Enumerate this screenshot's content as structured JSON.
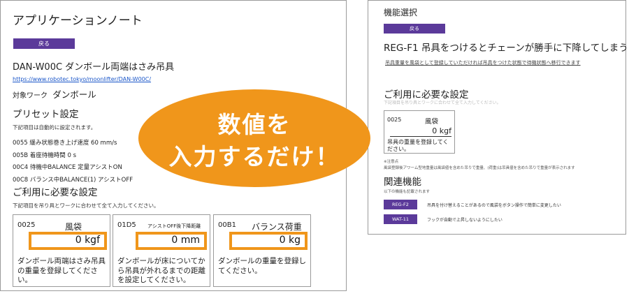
{
  "left": {
    "title": "アプリケーションノート",
    "back_label": "戻る",
    "heading": "DAN-W00C ダンボール両端はさみ吊具",
    "url": "https://www.robotec.tokyo/moonlifter/DAN-W00C/",
    "work_label": "対象ワーク",
    "work_value": "ダンボール",
    "preset_title": "プリセット設定",
    "preset_note": "下記項目は自動的に設定されます。",
    "preset_items": [
      "0055 緩み状態巻き上げ速度 60 mm/s",
      "005B 着座待機時間 0 s",
      "00C4 待機中BALANCE 定量アシストON",
      "00C8 バランス中BALANCE(1) アシストOFF"
    ],
    "required_title": "ご利用に必要な設定",
    "required_note": "下記項目を吊り具とワークに合わせて全て入力してください。",
    "cards": [
      {
        "code": "0025",
        "name": "風袋",
        "value": "0 kgf",
        "desc": "ダンボール両端はさみ吊具の重量を登録してください。"
      },
      {
        "code": "01D5",
        "name": "アシストOFF後下降距離",
        "value": "0 mm",
        "desc": "ダンボールが床についてから吊具が外れるまでの距離を設定してください。"
      },
      {
        "code": "00B1",
        "name": "バランス荷重",
        "value": "0 kg",
        "desc": "ダンボールの重量を登録してください。"
      }
    ]
  },
  "right": {
    "title": "機能選択",
    "back_label": "戻る",
    "heading": "REG-F1 吊具をつけるとチェーンが勝手に下降してしまう",
    "link_text": "吊具重量を風袋として登録していただければ吊具をつけた状態で待機状態へ移行できます",
    "required_title": "ご利用に必要な設定",
    "required_note": "下記項目を吊り具とワークに合わせて全て入力してください。",
    "card": {
      "code": "0025",
      "name": "風袋",
      "value": "0 kgf",
      "desc": "吊具の重量を登録してください。"
    },
    "note_label": "※注意点",
    "note_text": "風袋登録後アワーム型地重量は風袋値を含めた吊りで重量、(荷重)は吊具値を含めた吊りで重量が表示されます",
    "related_title": "関連機能",
    "related_note": "以下の機能も記載されます",
    "related": [
      {
        "label": "REG-F2",
        "text": "吊具を付け替えることがあるので風袋をボタン操作で簡単に変更したい"
      },
      {
        "label": "WAT-11",
        "text": "フックが自動で上昇しないようにしたい"
      }
    ]
  },
  "callout": {
    "line1": "数値を",
    "line2": "入力するだけ！"
  },
  "colors": {
    "accent": "#5b3a9a",
    "highlight": "#f0961b",
    "link": "#1a56c9"
  }
}
